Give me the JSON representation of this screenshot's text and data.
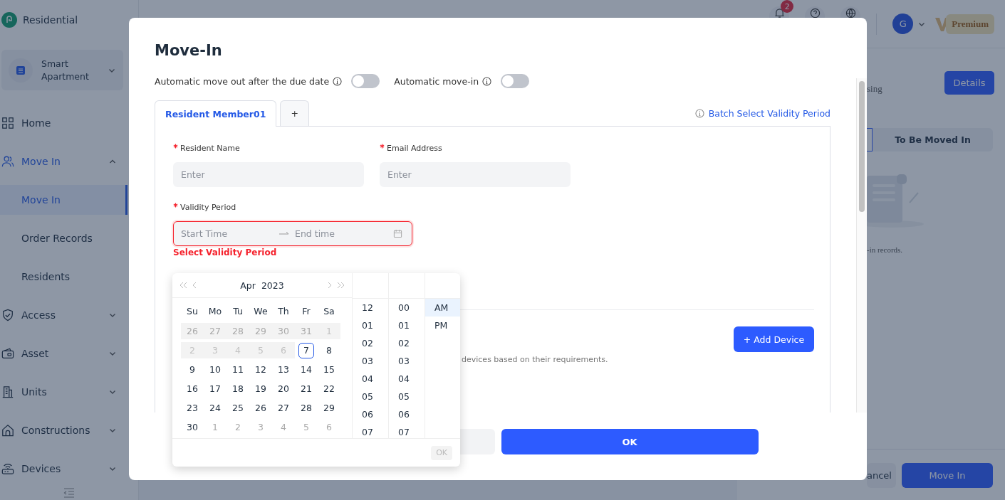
{
  "app": {
    "name": "Residential"
  },
  "project": {
    "name": "Smart Apartment"
  },
  "nav": [
    {
      "label": "Home",
      "kind": "link"
    },
    {
      "label": "Move In",
      "kind": "group",
      "expanded": true,
      "children": [
        {
          "label": "Move In",
          "selected": true
        },
        {
          "label": "Order Records",
          "selected": false
        },
        {
          "label": "Residents",
          "selected": false
        }
      ]
    },
    {
      "label": "Access",
      "kind": "group",
      "expanded": false
    },
    {
      "label": "Asset",
      "kind": "group",
      "expanded": false
    },
    {
      "label": "Units",
      "kind": "group",
      "expanded": false
    },
    {
      "label": "Constructions",
      "kind": "group",
      "expanded": false
    },
    {
      "label": "Devices",
      "kind": "group",
      "expanded": false
    }
  ],
  "header": {
    "notification_count": "2",
    "avatar_initial": "G",
    "plan": "Premium"
  },
  "panel": {
    "subtitle": "sing",
    "details_button": "Details",
    "tabs": [
      {
        "selected": true
      },
      {
        "label": "To Be Moved In",
        "selected": false
      }
    ],
    "empty_text": "-in records.",
    "buttons": [
      {
        "label": "ancel",
        "kind": "secondary"
      },
      {
        "label": "Move In",
        "kind": "primary"
      }
    ]
  },
  "modal": {
    "title": "Move-In",
    "toggles": [
      {
        "label": "Automatic move out after the due date",
        "on": false
      },
      {
        "label": "Automatic move-in",
        "on": false
      }
    ],
    "tabs": [
      {
        "label": "Resident Member01",
        "selected": true
      },
      {
        "label": "+",
        "selected": false
      }
    ],
    "batch_link": "Batch Select Validity Period",
    "fields": [
      {
        "label": "Resident Name",
        "required": true,
        "placeholder": "Enter"
      },
      {
        "label": "Email Address",
        "required": true,
        "placeholder": "Enter"
      }
    ],
    "validity": {
      "label": "Validity Period",
      "required": true,
      "start_placeholder": "Start Time",
      "end_placeholder": "End time",
      "error": true,
      "error_text": "Select Validity Period"
    },
    "devices_note": "devices based on their requirements.",
    "add_device_button": "+ Add Device",
    "ok_button": "OK"
  },
  "date_picker": {
    "month": "Apr",
    "year": "2023",
    "weekdays": [
      "Su",
      "Mo",
      "Tu",
      "We",
      "Th",
      "Fr",
      "Sa"
    ],
    "weeks": [
      [
        {
          "label": "26",
          "disabled": true,
          "outside": true,
          "today": false
        },
        {
          "label": "27",
          "disabled": true,
          "outside": true,
          "today": false
        },
        {
          "label": "28",
          "disabled": true,
          "outside": true,
          "today": false
        },
        {
          "label": "29",
          "disabled": true,
          "outside": true,
          "today": false
        },
        {
          "label": "30",
          "disabled": true,
          "outside": true,
          "today": false
        },
        {
          "label": "31",
          "disabled": true,
          "outside": true,
          "today": false
        },
        {
          "label": "1",
          "disabled": true,
          "outside": false,
          "today": false
        }
      ],
      [
        {
          "label": "2",
          "disabled": true,
          "outside": false,
          "today": false
        },
        {
          "label": "3",
          "disabled": true,
          "outside": false,
          "today": false
        },
        {
          "label": "4",
          "disabled": true,
          "outside": false,
          "today": false
        },
        {
          "label": "5",
          "disabled": true,
          "outside": false,
          "today": false
        },
        {
          "label": "6",
          "disabled": true,
          "outside": false,
          "today": false
        },
        {
          "label": "7",
          "disabled": false,
          "outside": false,
          "today": true
        },
        {
          "label": "8",
          "disabled": false,
          "outside": false,
          "today": false
        }
      ],
      [
        {
          "label": "9",
          "disabled": false,
          "outside": false,
          "today": false
        },
        {
          "label": "10",
          "disabled": false,
          "outside": false,
          "today": false
        },
        {
          "label": "11",
          "disabled": false,
          "outside": false,
          "today": false
        },
        {
          "label": "12",
          "disabled": false,
          "outside": false,
          "today": false
        },
        {
          "label": "13",
          "disabled": false,
          "outside": false,
          "today": false
        },
        {
          "label": "14",
          "disabled": false,
          "outside": false,
          "today": false
        },
        {
          "label": "15",
          "disabled": false,
          "outside": false,
          "today": false
        }
      ],
      [
        {
          "label": "16",
          "disabled": false,
          "outside": false,
          "today": false
        },
        {
          "label": "17",
          "disabled": false,
          "outside": false,
          "today": false
        },
        {
          "label": "18",
          "disabled": false,
          "outside": false,
          "today": false
        },
        {
          "label": "19",
          "disabled": false,
          "outside": false,
          "today": false
        },
        {
          "label": "20",
          "disabled": false,
          "outside": false,
          "today": false
        },
        {
          "label": "21",
          "disabled": false,
          "outside": false,
          "today": false
        },
        {
          "label": "22",
          "disabled": false,
          "outside": false,
          "today": false
        }
      ],
      [
        {
          "label": "23",
          "disabled": false,
          "outside": false,
          "today": false
        },
        {
          "label": "24",
          "disabled": false,
          "outside": false,
          "today": false
        },
        {
          "label": "25",
          "disabled": false,
          "outside": false,
          "today": false
        },
        {
          "label": "26",
          "disabled": false,
          "outside": false,
          "today": false
        },
        {
          "label": "27",
          "disabled": false,
          "outside": false,
          "today": false
        },
        {
          "label": "28",
          "disabled": false,
          "outside": false,
          "today": false
        },
        {
          "label": "29",
          "disabled": false,
          "outside": false,
          "today": false
        }
      ],
      [
        {
          "label": "30",
          "disabled": false,
          "outside": false,
          "today": false
        },
        {
          "label": "1",
          "disabled": false,
          "outside": true,
          "today": false
        },
        {
          "label": "2",
          "disabled": false,
          "outside": true,
          "today": false
        },
        {
          "label": "3",
          "disabled": false,
          "outside": true,
          "today": false
        },
        {
          "label": "4",
          "disabled": false,
          "outside": true,
          "today": false
        },
        {
          "label": "5",
          "disabled": false,
          "outside": true,
          "today": false
        },
        {
          "label": "6",
          "disabled": false,
          "outside": true,
          "today": false
        }
      ]
    ],
    "hours": [
      "12",
      "01",
      "02",
      "03",
      "04",
      "05",
      "06",
      "07"
    ],
    "minutes": [
      "00",
      "01",
      "02",
      "03",
      "04",
      "05",
      "06",
      "07"
    ],
    "periods": [
      {
        "label": "AM",
        "selected": true
      },
      {
        "label": "PM",
        "selected": false
      }
    ],
    "ok_button": {
      "label": "OK",
      "disabled": true
    }
  }
}
